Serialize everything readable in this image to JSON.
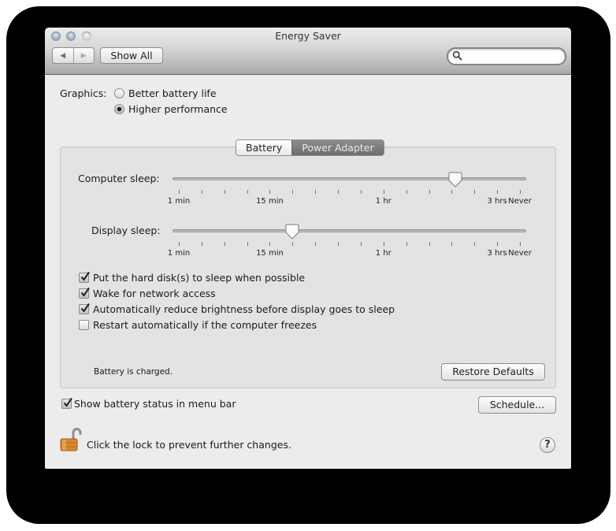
{
  "window": {
    "title": "Energy Saver",
    "traffic_lights": [
      "close",
      "minimize",
      "zoom"
    ]
  },
  "toolbar": {
    "back_icon": "◀",
    "forward_icon": "▶",
    "show_all_label": "Show All",
    "search": {
      "value": "",
      "placeholder": "",
      "icon": "search-icon"
    }
  },
  "graphics": {
    "label": "Graphics:",
    "options": [
      {
        "label": "Better battery life",
        "selected": false
      },
      {
        "label": "Higher performance",
        "selected": true
      }
    ]
  },
  "tabs": [
    {
      "label": "Battery",
      "active": false
    },
    {
      "label": "Power Adapter",
      "active": true
    }
  ],
  "sliders": {
    "tick_count": 16,
    "tick_labels": [
      {
        "text": "1 min",
        "tick": 0
      },
      {
        "text": "15 min",
        "tick": 4
      },
      {
        "text": "1 hr",
        "tick": 9
      },
      {
        "text": "3 hrs",
        "tick": 14
      },
      {
        "text": "Never",
        "tick": 15
      }
    ],
    "computer_sleep": {
      "label": "Computer sleep:",
      "position_fraction": 0.81
    },
    "display_sleep": {
      "label": "Display sleep:",
      "position_fraction": 0.333
    }
  },
  "options": [
    {
      "label": "Put the hard disk(s) to sleep when possible",
      "checked": true
    },
    {
      "label": "Wake for network access",
      "checked": true
    },
    {
      "label": "Automatically reduce brightness before display goes to sleep",
      "checked": true
    },
    {
      "label": "Restart automatically if the computer freezes",
      "checked": false
    }
  ],
  "status": {
    "battery_text": "Battery is charged."
  },
  "buttons": {
    "restore_defaults": "Restore Defaults",
    "schedule": "Schedule..."
  },
  "show_battery_status": {
    "label": "Show battery status in menu bar",
    "checked": true
  },
  "lock": {
    "text": "Click the lock to prevent further changes.",
    "state": "unlocked"
  },
  "help": {
    "label": "?"
  },
  "colors": {
    "window_bg": "#ececec",
    "groupbox_bg": "#e3e3e3",
    "active_tab": "#7d7d7d",
    "lock_body": "#d98a2c"
  }
}
